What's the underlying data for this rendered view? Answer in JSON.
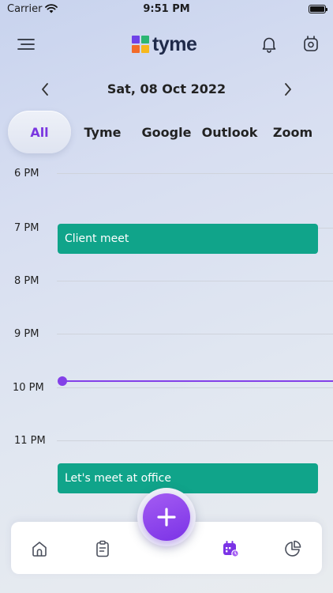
{
  "status_bar": {
    "carrier": "Carrier",
    "time": "9:51 PM"
  },
  "header": {
    "logo_text": "tyme",
    "logo_colors": [
      "#6f42e8",
      "#2bb673",
      "#f26b2a",
      "#f6b81d"
    ]
  },
  "date_nav": {
    "date": "Sat, 08 Oct 2022"
  },
  "filters": [
    {
      "label": "All",
      "active": true
    },
    {
      "label": "Tyme",
      "active": false
    },
    {
      "label": "Google",
      "active": false
    },
    {
      "label": "Outlook",
      "active": false
    },
    {
      "label": "Zoom",
      "active": false
    }
  ],
  "timeline": {
    "hours": [
      "6 PM",
      "7 PM",
      "8 PM",
      "9 PM",
      "10 PM",
      "11 PM"
    ],
    "events": [
      {
        "title": "Client meet",
        "color": "#10a48a"
      },
      {
        "title": "Let's meet at office",
        "color": "#10a48a"
      }
    ],
    "now_color": "#8340e8"
  },
  "bottom_nav": {
    "items": [
      "home-icon",
      "clipboard-icon",
      "calendar-icon",
      "pie-chart-icon"
    ],
    "active": "calendar-icon",
    "accent": "#7b33e6"
  }
}
